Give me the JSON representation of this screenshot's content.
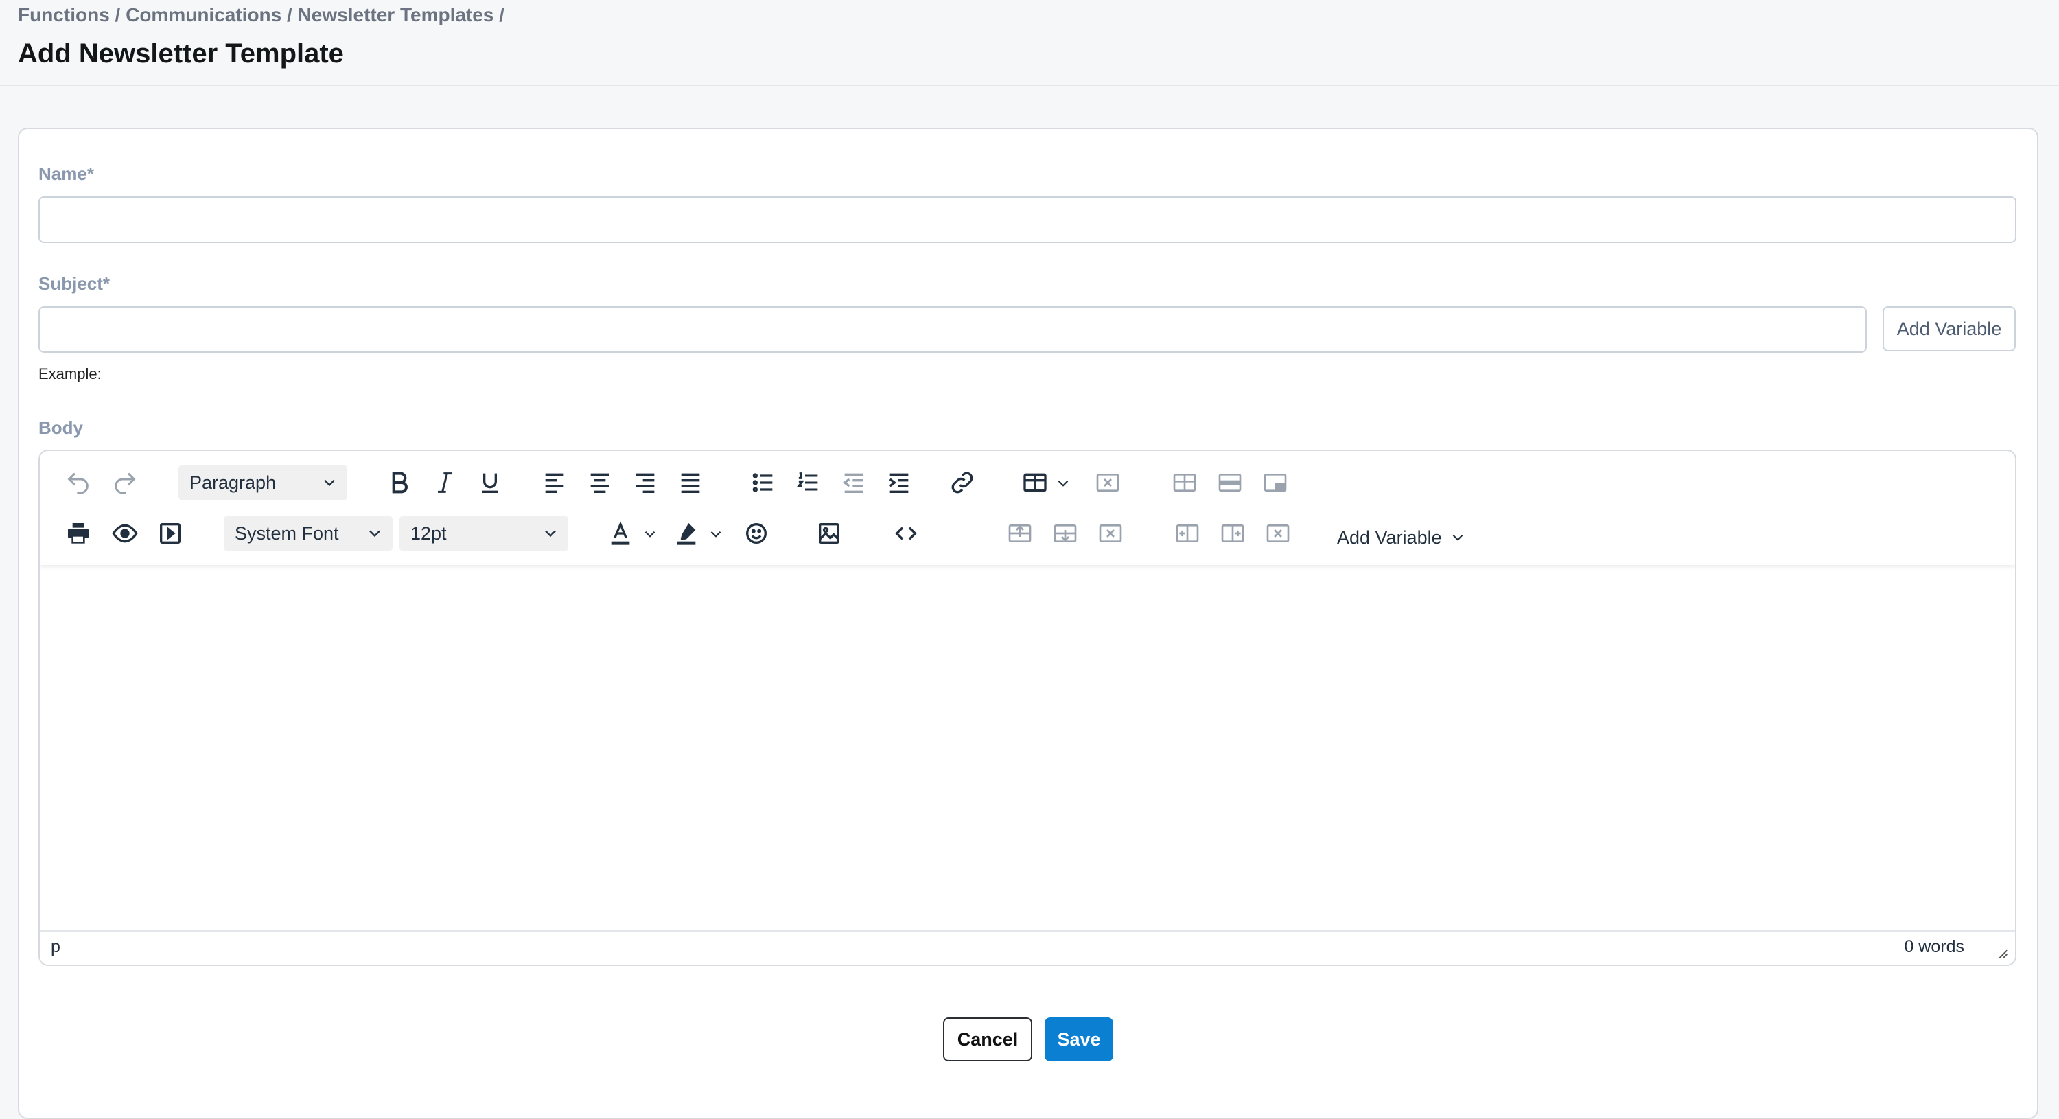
{
  "breadcrumb": "Functions / Communications / Newsletter Templates /",
  "page_title": "Add Newsletter Template",
  "form": {
    "name_label": "Name*",
    "name_value": "",
    "subject_label": "Subject*",
    "subject_value": "",
    "add_variable_label": "Add Variable",
    "example_label": "Example:",
    "body_label": "Body"
  },
  "editor": {
    "block_format": "Paragraph",
    "font_family": "System Font",
    "font_size": "12pt",
    "add_variable_menu": "Add Variable",
    "status_path": "p",
    "word_count": "0 words",
    "toolbar_row1": [
      "undo-icon",
      "redo-icon",
      "bold-icon",
      "italic-icon",
      "underline-icon",
      "align-left-icon",
      "align-center-icon",
      "align-right-icon",
      "justify-icon",
      "bullet-list-icon",
      "numbered-list-icon",
      "outdent-icon",
      "indent-icon",
      "link-icon",
      "table-icon",
      "delete-table-icon",
      "table-props-icon",
      "table-row-props-icon",
      "table-cell-props-icon"
    ],
    "toolbar_row2": [
      "print-icon",
      "preview-icon",
      "media-icon",
      "text-color-icon",
      "highlight-icon",
      "emoji-icon",
      "image-icon",
      "code-icon",
      "insert-row-before-icon",
      "insert-row-after-icon",
      "delete-row-icon",
      "insert-col-before-icon",
      "insert-col-after-icon",
      "delete-col-icon"
    ]
  },
  "actions": {
    "cancel_label": "Cancel",
    "save_label": "Save"
  },
  "colors": {
    "primary": "#0b7fd1",
    "label": "#8a98ad",
    "background": "#f6f7f9"
  }
}
